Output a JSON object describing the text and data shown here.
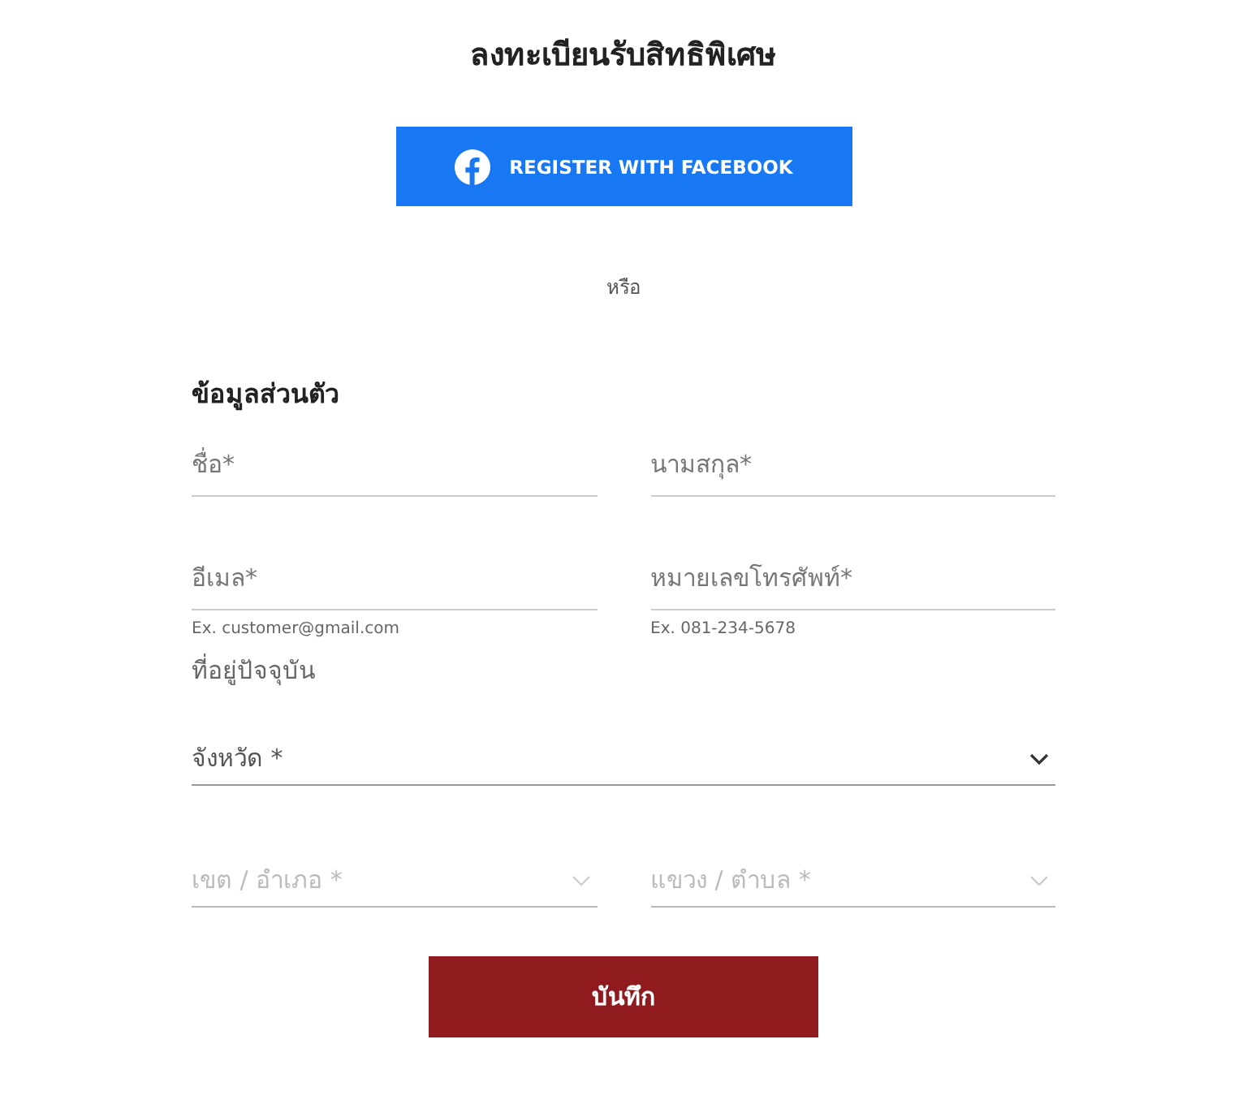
{
  "title": "ลงทะเบียนรับสิทธิพิเศษ",
  "facebook_button": {
    "label": "REGISTER WITH FACEBOOK"
  },
  "divider_text": "หรือ",
  "personal_section": {
    "heading": "ข้อมูลส่วนตัว",
    "fields": [
      {
        "placeholder": "ชื่อ*"
      },
      {
        "placeholder": "นามสกุล*"
      },
      {
        "placeholder": "อีเมล*",
        "hint": "Ex. customer@gmail.com"
      },
      {
        "placeholder": "หมายเลขโทรศัพท์*",
        "hint": "Ex. 081-234-5678"
      }
    ]
  },
  "address_section": {
    "heading": "ที่อยู่ปัจจุบัน",
    "selects": [
      {
        "placeholder": "จังหวัด *",
        "disabled": false
      },
      {
        "placeholder": "เขต / อำเภอ *",
        "disabled": true
      },
      {
        "placeholder": "แขวง / ตำบล *",
        "disabled": true
      }
    ]
  },
  "save_button": {
    "label": "บันทึก"
  }
}
